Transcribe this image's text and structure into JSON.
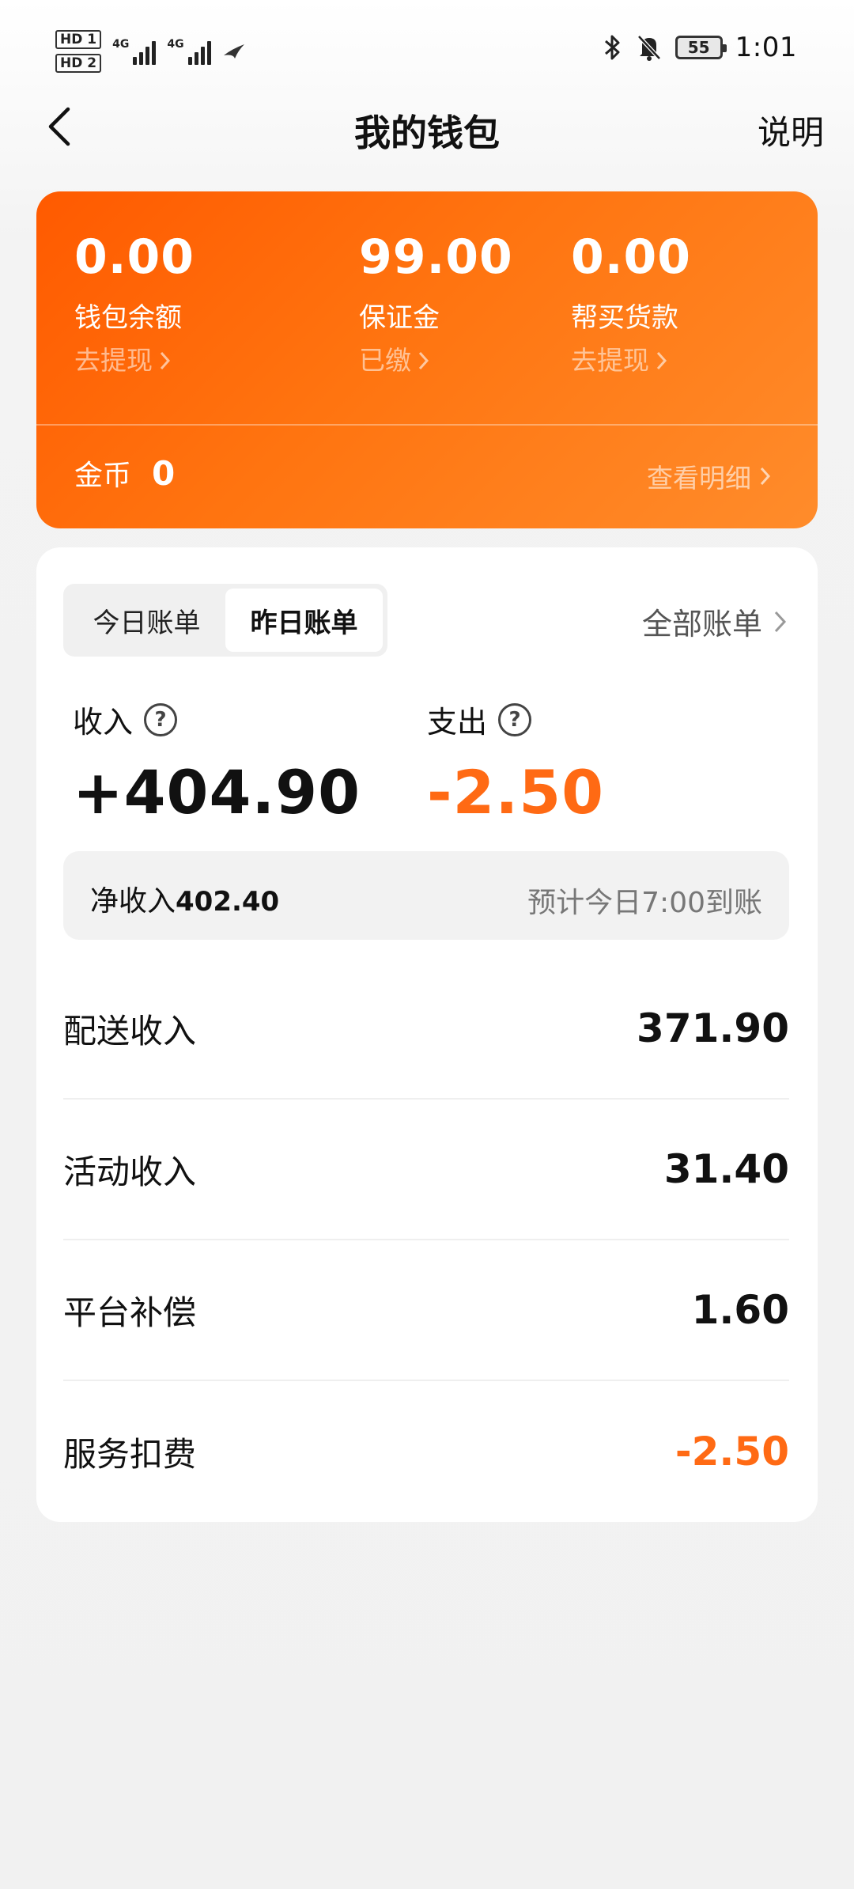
{
  "status_bar": {
    "hd1": "HD 1",
    "hd2": "HD 2",
    "net1": "4G",
    "net2": "4G",
    "battery": "55",
    "time": "1:01"
  },
  "nav": {
    "title": "我的钱包",
    "right_label": "说明"
  },
  "wallet": {
    "balance": {
      "amount": "0.00",
      "label": "钱包余额",
      "action": "去提现"
    },
    "deposit": {
      "amount": "99.00",
      "label": "保证金",
      "action": "已缴"
    },
    "purchase": {
      "amount": "0.00",
      "label": "帮买货款",
      "action": "去提现"
    },
    "coins_label": "金币",
    "coins_value": "0",
    "detail_label": "查看明细"
  },
  "bills": {
    "tabs": [
      {
        "label": "今日账单",
        "active": false
      },
      {
        "label": "昨日账单",
        "active": true
      }
    ],
    "all_label": "全部账单",
    "income_label": "收入",
    "income_value": "+404.90",
    "expense_label": "支出",
    "expense_value": "-2.50",
    "net_label": "净收入",
    "net_value": "402.40",
    "net_note": "预计今日7:00到账",
    "rows": [
      {
        "label": "配送收入",
        "value": "371.90",
        "negative": false
      },
      {
        "label": "活动收入",
        "value": "31.40",
        "negative": false
      },
      {
        "label": "平台补偿",
        "value": "1.60",
        "negative": false
      },
      {
        "label": "服务扣费",
        "value": "-2.50",
        "negative": true
      }
    ]
  },
  "colors": {
    "accent": "#ff6a14",
    "card_start": "#ff5a00",
    "card_end": "#ff8c2b"
  }
}
